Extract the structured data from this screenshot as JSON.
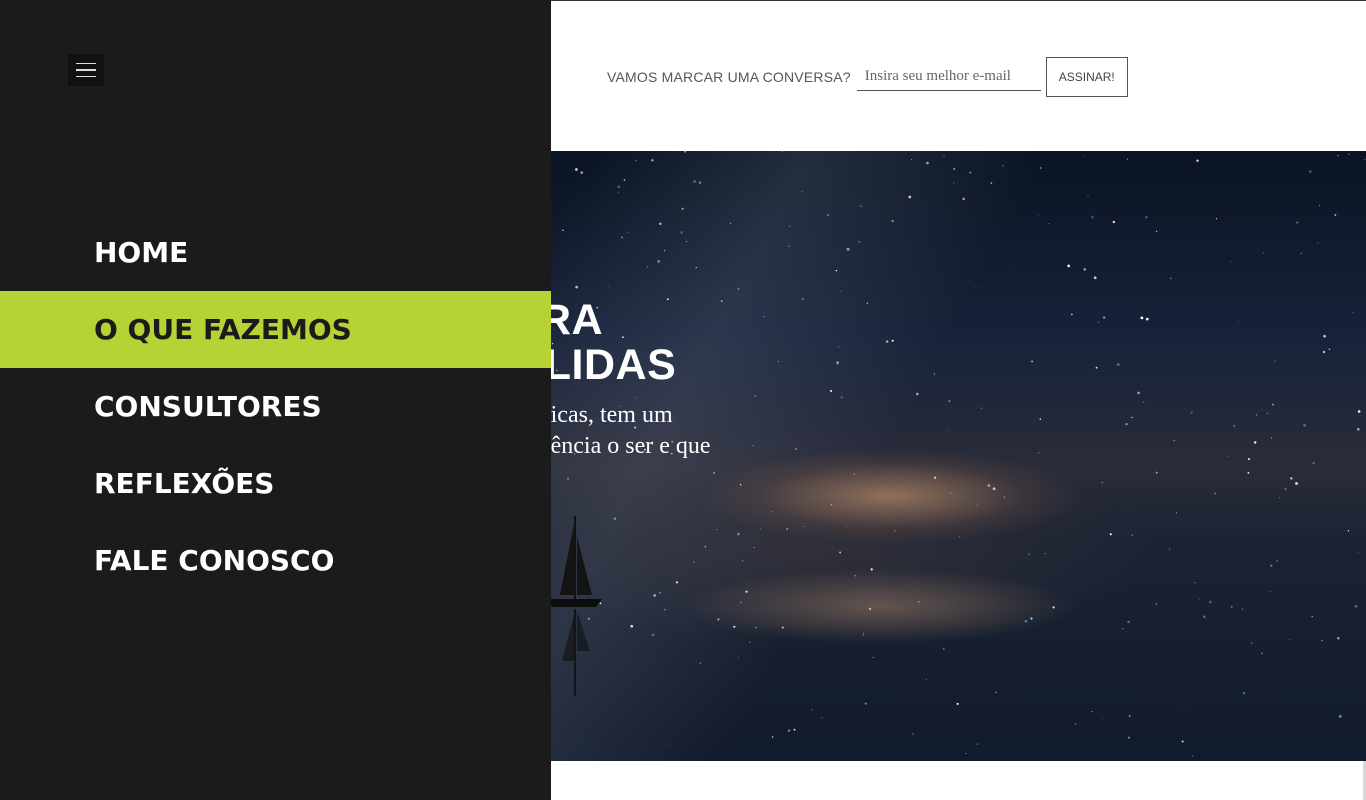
{
  "header": {
    "newsletter_label": "VAMOS MARCAR UMA CONVERSA?",
    "email_placeholder": "Insira seu melhor e-mail",
    "subscribe_label": "ASSINAR!"
  },
  "hero": {
    "title": "A PARA\nS SÓLIDAS",
    "subtitle": "ções são únicas, tem um\nar que influência o ser e que"
  },
  "drawer": {
    "menu_icon": "hamburger-icon",
    "items": [
      {
        "label": "HOME",
        "active": false
      },
      {
        "label": "O QUE FAZEMOS",
        "active": true
      },
      {
        "label": "CONSULTORES",
        "active": false
      },
      {
        "label": "REFLEXÕES",
        "active": false
      },
      {
        "label": "FALE CONOSCO",
        "active": false
      }
    ]
  },
  "colors": {
    "drawer_bg": "#1b1b1b",
    "accent": "#b5d335",
    "text_light": "#ffffff"
  }
}
